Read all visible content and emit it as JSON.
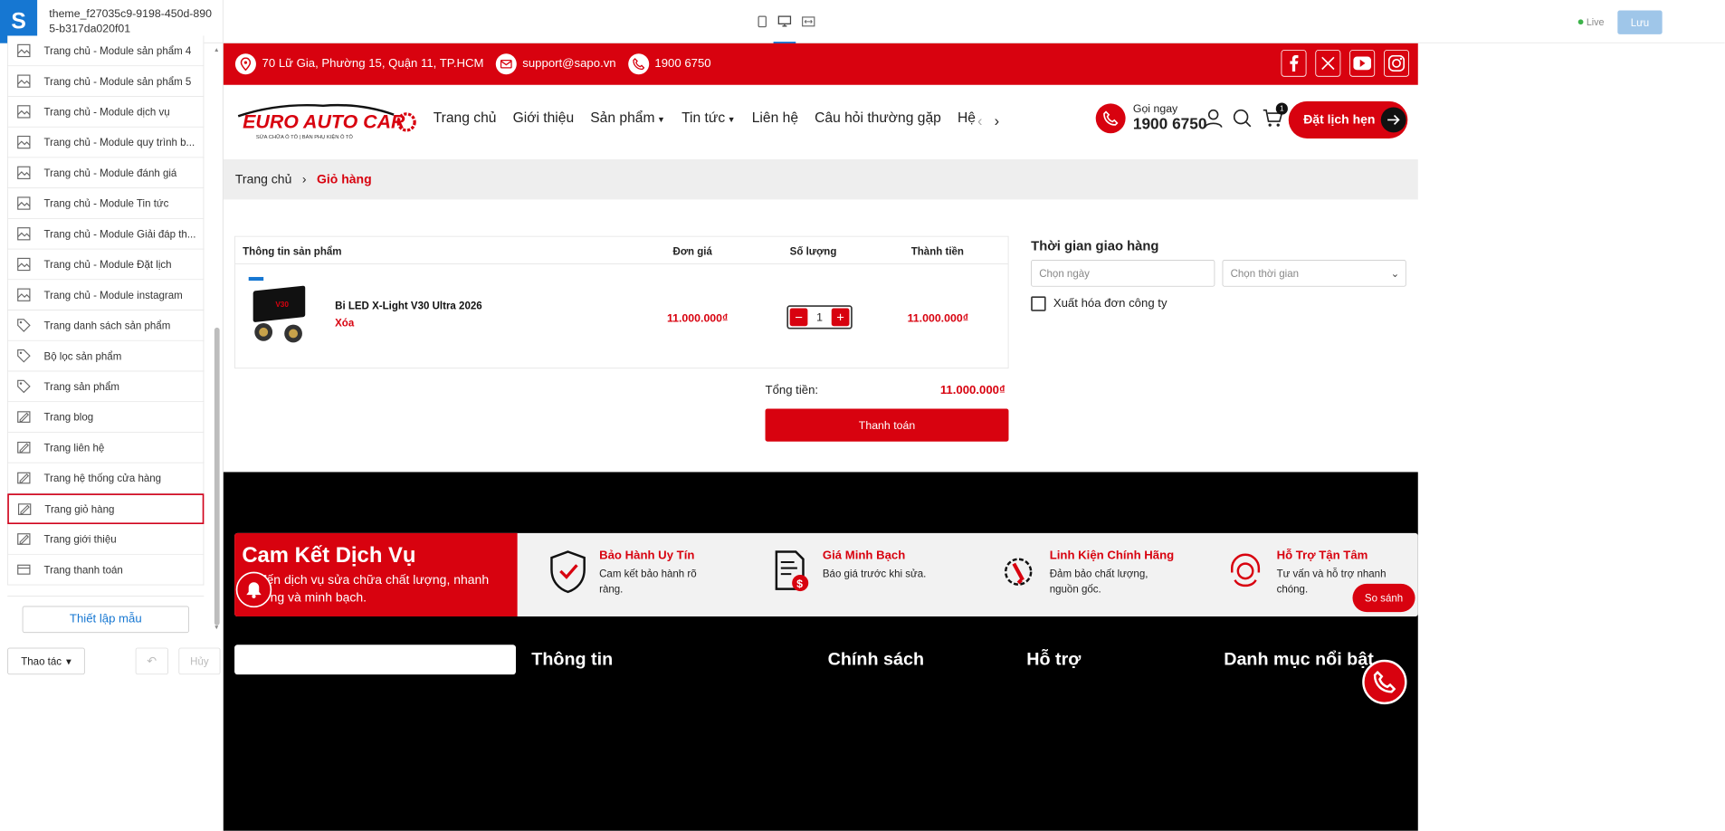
{
  "editor": {
    "theme_name": "theme_f27035c9-9198-450d-8905-b317da020f01",
    "items": [
      {
        "label": "Trang chủ - Module sản phẩm 4",
        "icon": "layout-icon"
      },
      {
        "label": "Trang chủ - Module sản phẩm 5",
        "icon": "layout-icon"
      },
      {
        "label": "Trang chủ - Module dịch vụ",
        "icon": "layout-icon"
      },
      {
        "label": "Trang chủ - Module quy trình b...",
        "icon": "layout-icon"
      },
      {
        "label": "Trang chủ - Module đánh giá",
        "icon": "layout-icon"
      },
      {
        "label": "Trang chủ - Module Tin tức",
        "icon": "layout-icon"
      },
      {
        "label": "Trang chủ - Module Giải đáp th...",
        "icon": "layout-icon"
      },
      {
        "label": "Trang chủ - Module Đặt lịch",
        "icon": "layout-icon"
      },
      {
        "label": "Trang chủ - Module instagram",
        "icon": "layout-icon"
      },
      {
        "label": "Trang danh sách sản phẩm",
        "icon": "tag-icon"
      },
      {
        "label": "Bộ lọc sản phẩm",
        "icon": "tag-icon"
      },
      {
        "label": "Trang sản phẩm",
        "icon": "tag-icon"
      },
      {
        "label": "Trang blog",
        "icon": "pen-icon"
      },
      {
        "label": "Trang liên hệ",
        "icon": "pen-icon"
      },
      {
        "label": "Trang hệ thống cửa hàng",
        "icon": "pen-icon"
      },
      {
        "label": "Trang giỏ hàng",
        "icon": "pen-icon"
      },
      {
        "label": "Trang giới thiệu",
        "icon": "pen-icon"
      },
      {
        "label": "Trang thanh toán",
        "icon": "card-icon"
      }
    ],
    "active_item": "Trang giỏ hàng",
    "template_button": "Thiết lập mẫu",
    "action_button": "Thao tác",
    "cancel_button": "Hủy"
  },
  "topbar": {
    "status": "Live",
    "save_label": "Lưu",
    "status_color": "#3db34a",
    "accent": "#1677d2"
  },
  "store": {
    "brand_color": "#d8020f",
    "address": "70 Lữ Gia, Phường 15, Quận 11, TP.HCM",
    "email": "support@sapo.vn",
    "phone": "1900 6750",
    "brand_name": "EURO AUTO CAR",
    "brand_tagline": "SỬA CHỮA Ô TÔ  |  BÁN PHỤ KIỆN Ô TÔ",
    "menu": [
      "Trang chủ",
      "Giới thiệu",
      "Sản phẩm",
      "Tin tức",
      "Liên hệ",
      "Câu hỏi thường gặp",
      "Hệ"
    ],
    "call_label": "Gọi ngay",
    "call_number": "1900 6750",
    "cart_count": "1",
    "book_label": "Đặt lịch hẹn",
    "breadcrumb": {
      "home": "Trang chủ",
      "current": "Giỏ hàng"
    }
  },
  "cart": {
    "headers": {
      "info": "Thông tin sản phẩm",
      "price": "Đơn giá",
      "qty": "Số lượng",
      "total": "Thành tiền"
    },
    "item": {
      "name": "Bi LED X-Light V30 Ultra 2026",
      "remove": "Xóa",
      "price": "11.000.000₫",
      "qty": "1",
      "total": "11.000.000₫"
    },
    "sum_label": "Tổng tiền:",
    "sum_value": "11.000.000₫",
    "pay_label": "Thanh toán"
  },
  "delivery": {
    "title": "Thời gian giao hàng",
    "date_placeholder": "Chọn ngày",
    "time_placeholder": "Chọn thời gian",
    "invoice_label": "Xuất hóa đơn công ty"
  },
  "footer": {
    "commit_title": "Cam Kết Dịch Vụ",
    "commit_text": "ng đến dịch vụ sửa chữa chất lượng, nhanh\nng và minh bạch.",
    "commits": [
      {
        "title": "Bảo Hành Uy Tín",
        "text": "Cam kết bảo hành rõ\nràng.",
        "icon": "shield-check-icon"
      },
      {
        "title": "Giá Minh Bạch",
        "text": "Báo giá trước khi sửa.",
        "icon": "invoice-dollar-icon"
      },
      {
        "title": "Linh Kiện Chính Hãng",
        "text": "Đảm bảo chất lượng,\nnguồn gốc.",
        "icon": "gear-wrench-icon"
      },
      {
        "title": "Hỗ Trợ Tận Tâm",
        "text": "Tư vấn và hỗ trợ nhanh\nchóng.",
        "icon": "headset-icon"
      }
    ],
    "compare": "So sánh",
    "headings": [
      "Thông tin",
      "Chính sách",
      "Hỗ trợ",
      "Danh mục nổi bật"
    ]
  }
}
